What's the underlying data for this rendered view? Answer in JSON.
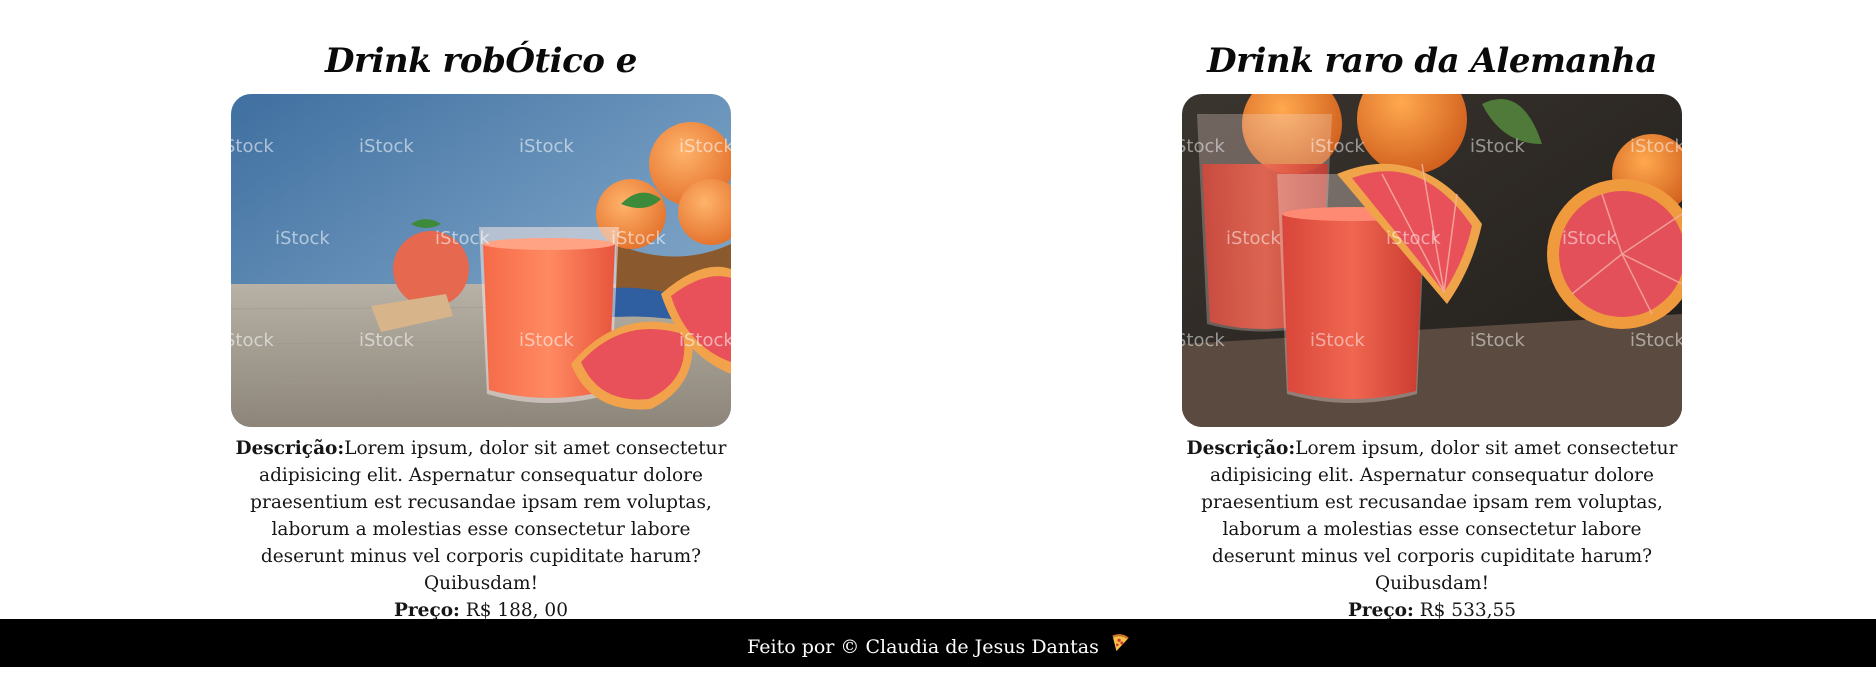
{
  "cards": [
    {
      "title": "Drink robÓtico e sustentÁvel",
      "image_alt": "Copo de suco de toranja com frutas sobre mesa de madeira e fundo azul",
      "description_label": "Descrição:",
      "description_text": "Lorem ipsum, dolor sit amet consectetur adipisicing elit. Aspernatur consequatur dolore praesentium est recusandae ipsam rem voluptas, laborum a molestias esse consectetur labore deserunt minus vel corporis cupiditate harum? Quibusdam!",
      "price_label": "Preço:",
      "price_value": "R$ 188, 00"
    },
    {
      "title": "Drink raro da Alemanha",
      "image_alt": "Copos de suco de toranja com fatias de toranja sobre tábua de madeira",
      "description_label": "Descrição:",
      "description_text": "Lorem ipsum, dolor sit amet consectetur adipisicing elit. Aspernatur consequatur dolore praesentium est recusandae ipsam rem voluptas, laborum a molestias esse consectetur labore deserunt minus vel corporis cupiditate harum? Quibusdam!",
      "price_label": "Preço:",
      "price_value": "R$ 533,55"
    }
  ],
  "watermark": "iStock",
  "footer": {
    "text": "Feito por © Claudia de Jesus Dantas",
    "icon": "pizza-icon"
  },
  "colors": {
    "footer_bg": "#000000",
    "footer_text": "#ffffff",
    "juice": "#f2604a",
    "grapefruit_flesh": "#e8505a"
  }
}
